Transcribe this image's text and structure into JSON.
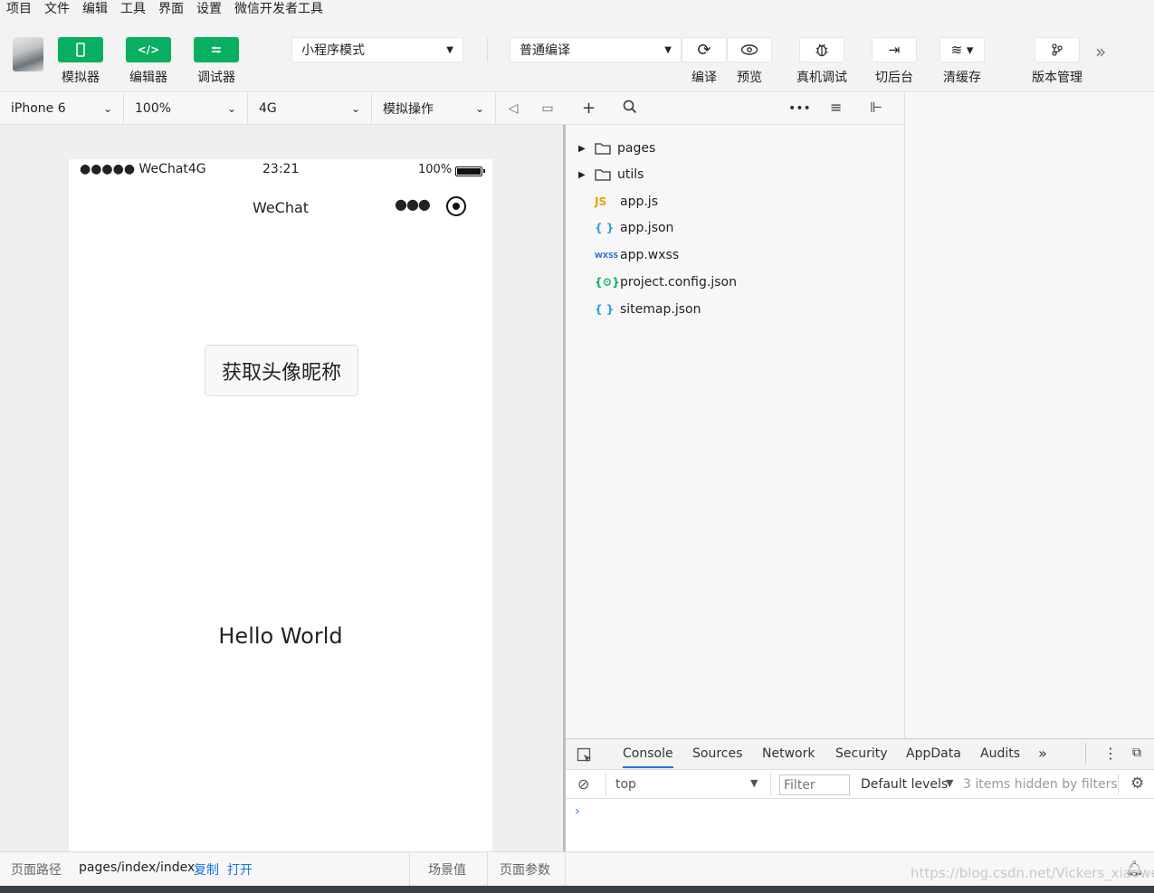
{
  "menu": [
    "项目",
    "文件",
    "编辑",
    "工具",
    "界面",
    "设置",
    "微信开发者工具"
  ],
  "toolbar": {
    "simulator": "模拟器",
    "editor": "编辑器",
    "debugger": "调试器",
    "mode": "小程序模式",
    "compile_mode": "普通编译",
    "compile": "编译",
    "preview": "预览",
    "remote_debug": "真机调试",
    "background": "切后台",
    "clear_cache": "清缓存",
    "version": "版本管理"
  },
  "device": {
    "model": "iPhone 6",
    "zoom": "100%",
    "network": "4G",
    "sim_action": "模拟操作"
  },
  "phone": {
    "carrier": "●●●●● WeChat4G",
    "time": "23:21",
    "battery": "100%",
    "title": "WeChat",
    "button": "获取头像昵称",
    "hello": "Hello World"
  },
  "explorer": {
    "items": [
      {
        "name": "pages",
        "type": "folder"
      },
      {
        "name": "utils",
        "type": "folder"
      },
      {
        "name": "app.js",
        "type": "js"
      },
      {
        "name": "app.json",
        "type": "json"
      },
      {
        "name": "app.wxss",
        "type": "wxss"
      },
      {
        "name": "project.config.json",
        "type": "config"
      },
      {
        "name": "sitemap.json",
        "type": "json"
      }
    ]
  },
  "devtools": {
    "tabs": [
      "Console",
      "Sources",
      "Network",
      "Security",
      "AppData",
      "Audits"
    ],
    "context": "top",
    "filter_placeholder": "Filter",
    "levels": "Default levels",
    "hidden": "3 items hidden by filters"
  },
  "footer": {
    "path_label": "页面路径",
    "path": "pages/index/index",
    "copy": "复制",
    "open": "打开",
    "scene": "场景值",
    "params": "页面参数"
  },
  "watermark": "https://blog.csdn.net/Vickers_xiaowei",
  "colors": {
    "accent": "#07b060",
    "link": "#1a73e8",
    "js": "#e8a100",
    "json": "#2a9fd6",
    "wxss": "#2a6fd6",
    "config": "#07b060"
  }
}
